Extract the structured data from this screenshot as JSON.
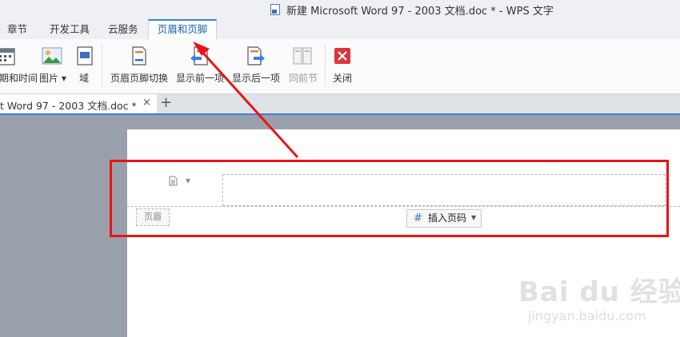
{
  "window": {
    "title": "新建 Microsoft Word 97 - 2003 文档.doc * - WPS 文字"
  },
  "menu": {
    "tabs": [
      {
        "label": "章节"
      },
      {
        "label": "开发工具"
      },
      {
        "label": "云服务"
      },
      {
        "label": "页眉和页脚",
        "active": true
      }
    ]
  },
  "ribbon": {
    "date_time": "期和时间",
    "picture": "图片",
    "field": "域",
    "switch_header_footer": "页眉页脚切换",
    "show_previous": "显示前一项",
    "show_next": "显示后一项",
    "same_as_previous": "同前节",
    "close": "关闭"
  },
  "doc_tabs": {
    "active_label": "t Word 97 - 2003 文档.doc *",
    "close": "×",
    "new_tab": "+"
  },
  "header_area": {
    "label": "页眉",
    "insert_page_number": "插入页码"
  },
  "watermark": {
    "brand": "Bai du 经验",
    "url": "jingyan.baidu.com"
  },
  "colors": {
    "accent": "#3b7fd8",
    "highlight": "#e8141b",
    "close_icon": "#d9363e"
  }
}
